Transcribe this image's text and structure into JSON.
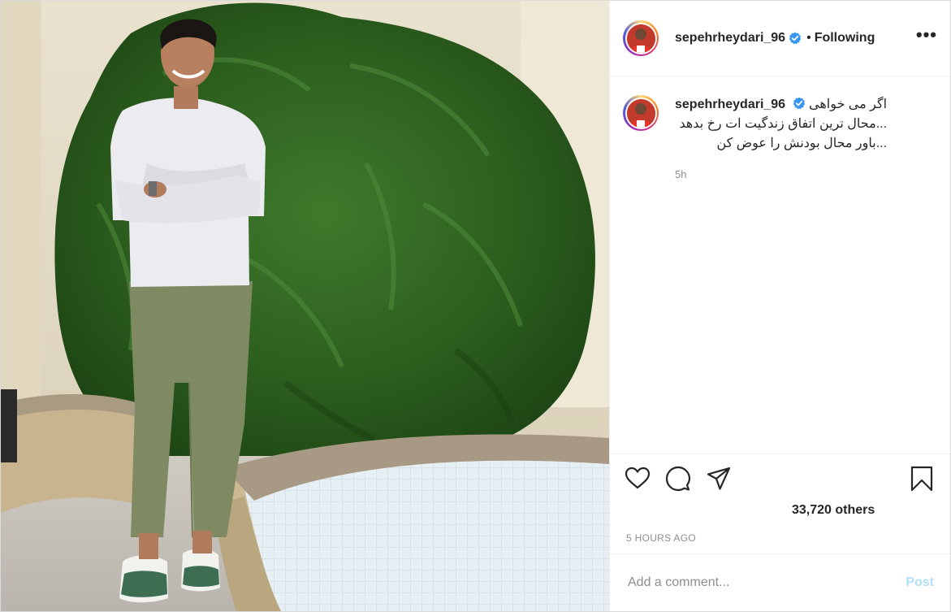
{
  "post": {
    "username": "sepehrheydari_96",
    "verified": true,
    "separator": "•",
    "following_label": "Following",
    "more_label": "•••"
  },
  "caption": {
    "username": "sepehrheydari_96",
    "lines": [
      "اگر می خواهی",
      "...محال ترین اتفاق زندگیت ات رخ بدهد",
      "...باور محال بودنش را عوض کن"
    ],
    "time": "5h"
  },
  "actions": {
    "like_icon": "heart-icon",
    "comment_icon": "comment-bubble-icon",
    "share_icon": "paper-plane-icon",
    "save_icon": "bookmark-icon",
    "likes_text": "33,720 others",
    "timestamp": "5 HOURS AGO"
  },
  "comment": {
    "placeholder": "Add a comment...",
    "post_label": "Post"
  },
  "colors": {
    "verified_badge": "#3897f0",
    "post_button_disabled": "#b2dffc",
    "muted_text": "#8e8e8e"
  }
}
